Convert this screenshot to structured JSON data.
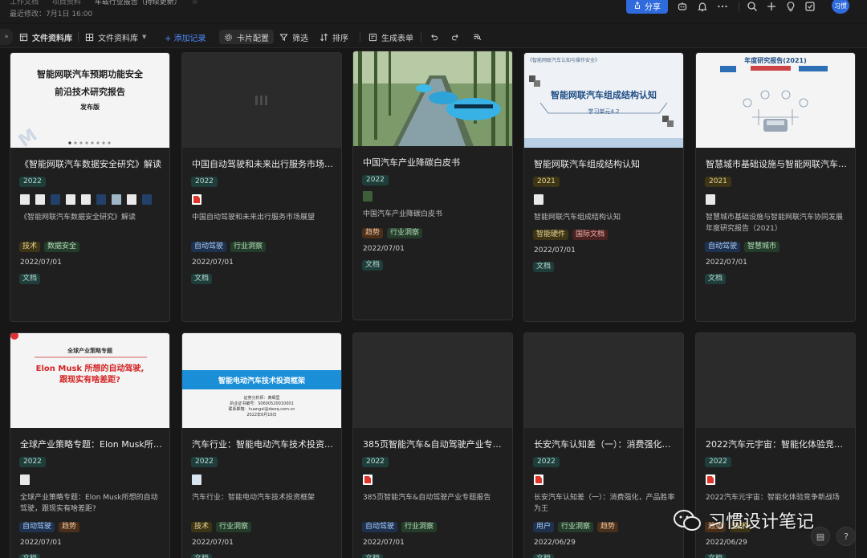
{
  "header": {
    "breadcrumbs": [
      "工作文档",
      "项目资料",
      "车载行业报告（持续更新）"
    ],
    "modified": "最近修改：7月1日 16:00",
    "share_label": "分享",
    "avatar_text": "习惯",
    "icons": [
      "bot-icon",
      "bell-icon",
      "more-icon",
      "search-icon",
      "plus-icon",
      "bulb-icon",
      "checkbox-icon"
    ]
  },
  "toolbar": {
    "view_name": "文件资料库",
    "view_switch": "文件资料库",
    "add_record": "+ 添加记录",
    "card_config": "卡片配置",
    "filter": "筛选",
    "sort": "排序",
    "generate_form": "生成表单"
  },
  "covers": {
    "c0_line1": "智能网联汽车预期功能安全",
    "c0_line2": "前沿技术研究报告",
    "c0_line3": "发布版",
    "c3_top": "《智能网联汽车认知与操作安全》",
    "c3_title": "智能网联汽车组成结构认知",
    "c3_sub": "学习单元4.2",
    "c4_title": "年度研究报告(2021)",
    "c5_top": "全球产业策略专题",
    "c5_title1": "Elon Musk 所想的自动驾驶,",
    "c5_title2": "跟现实有啥差距?",
    "c6_title": "智能电动汽车技术投资框架",
    "c6_line1": "证券分析师：黄细里",
    "c6_line2": "执业证书编号：S0600520010001",
    "c6_line3": "联系邮箱：huangxl@dwzq.com.cn",
    "c6_line4": "2022年6月16日"
  },
  "cards": [
    {
      "title": "《智能网联汽车数据安全研究》解读",
      "year": "2022",
      "desc": "《智能网联汽车数据安全研究》解读",
      "tags": [
        "技术",
        "数据安全"
      ],
      "date": "2022/07/01",
      "type": "文档"
    },
    {
      "title": "中国自动驾驶和未来出行服务市场展望",
      "year": "2022",
      "desc": "中国自动驾驶和未来出行服务市场展望",
      "tags": [
        "自动驾驶",
        "行业洞察"
      ],
      "date": "2022/07/01",
      "type": "文档"
    },
    {
      "title": "中国汽车产业降碳白皮书",
      "year": "2022",
      "desc": "中国汽车产业降碳白皮书",
      "tags": [
        "趋势",
        "行业洞察"
      ],
      "date": "2022/07/01",
      "type": "文档"
    },
    {
      "title": "智能网联汽车组成结构认知",
      "year": "2021",
      "desc": "智能网联汽车组成结构认知",
      "tags": [
        "智能硬件",
        "国际文档"
      ],
      "date": "2022/07/01",
      "type": "文档"
    },
    {
      "title": "智慧城市基础设施与智能网联汽车协同发展年度研究报告",
      "year": "2021",
      "desc": "智慧城市基础设施与智能网联汽车协同发展年度研究报告（2021）",
      "tags": [
        "自动驾驶",
        "智慧城市"
      ],
      "date": "2022/07/01",
      "type": "文档"
    },
    {
      "title": "全球产业策略专题：Elon Musk所想的自动驾驶",
      "year": "2022",
      "desc": "全球产业策略专题：Elon Musk所想的自动驾驶，跟现实有啥差距?",
      "tags": [
        "自动驾驶",
        "趋势"
      ],
      "date": "2022/07/01",
      "type": "文档"
    },
    {
      "title": "汽车行业：智能电动汽车技术投资框架",
      "year": "2022",
      "desc": "汽车行业：智能电动汽车技术投资框架",
      "tags": [
        "技术",
        "行业洞察"
      ],
      "date": "2022/07/01",
      "type": "文档"
    },
    {
      "title": "385页智能汽车&自动驾驶产业专题报告",
      "year": "2022",
      "desc": "385页智能汽车&自动驾驶产业专题报告",
      "tags": [
        "自动驾驶",
        "行业洞察"
      ],
      "date": "2022/07/01",
      "type": "文档"
    },
    {
      "title": "长安汽车认知差（一）：消费强化，产品胜率为王",
      "year": "2022",
      "desc": "长安汽车认知差（一）：消费强化，产品胜率为王",
      "tags": [
        "用户",
        "行业洞察",
        "趋势"
      ],
      "date": "2022/06/29",
      "type": "文档"
    },
    {
      "title": "2022汽车元宇宙：智能化体验竞争新战场",
      "year": "2022",
      "desc": "2022汽车元宇宙：智能化体验竞争新战场",
      "tags": [
        "趋势",
        "技术"
      ],
      "date": "2022/06/29",
      "type": "文档"
    }
  ],
  "watermark": "习惯设计笔记"
}
